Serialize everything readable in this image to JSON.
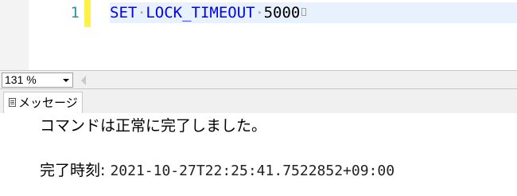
{
  "editor": {
    "line_number": "1",
    "code": {
      "keyword1": "SET",
      "keyword2": "LOCK_TIMEOUT",
      "value": "5000"
    }
  },
  "statusbar": {
    "zoom": "131 %"
  },
  "results": {
    "tab_label": "メッセージ",
    "message": "コマンドは正常に完了しました。",
    "completion_label": "完了時刻: ",
    "completion_time": "2021-10-27T22:25:41.7522852+09:00"
  },
  "colors": {
    "keyword": "#0000ff",
    "line_number": "#2b91af",
    "change_bar": "#fff04a",
    "current_line": "#e8f2fe"
  }
}
